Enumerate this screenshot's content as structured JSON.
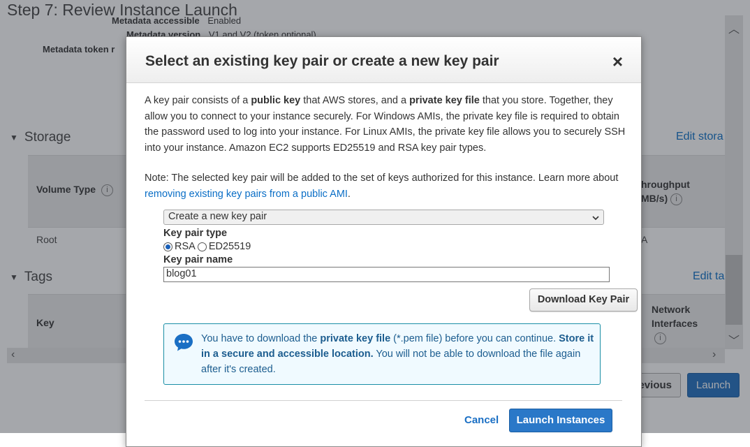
{
  "background": {
    "page_title": "Step 7: Review Instance Launch",
    "metadata_accessible_label": "Metadata accessible",
    "metadata_accessible_value": "Enabled",
    "metadata_version_label": "Metadata version",
    "metadata_version_value": "V1 and V2 (token optional)",
    "metadata_token_label": "Metadata token r",
    "storage_heading": "Storage",
    "storage_edit": "Edit stora",
    "volume_type_col": "Volume Type",
    "throughput_col_line1": "hroughput",
    "throughput_col_line2": "MB/s)",
    "root_cell": "Root",
    "na_cell": "A",
    "tags_heading": "Tags",
    "tags_edit": "Edit ta",
    "key_col": "Key",
    "network_col_line1": "Network",
    "network_col_line2": "Interfaces",
    "previous_button": "evious",
    "launch_button": "Launch",
    "info_glyph": "i"
  },
  "modal": {
    "title": "Select an existing key pair or create a new key pair",
    "close_glyph": "×",
    "intro": {
      "t1": "A key pair consists of a ",
      "b1": "public key",
      "t2": " that AWS stores, and a ",
      "b2": "private key file",
      "t3": " that you store. Together, they allow you to connect to your instance securely. For Windows AMIs, the private key file is required to obtain the password used to log into your instance. For Linux AMIs, the private key file allows you to securely SSH into your instance. Amazon EC2 supports ED25519 and RSA key pair types."
    },
    "note_text": "Note: The selected key pair will be added to the set of keys authorized for this instance. Learn more about ",
    "note_link": "removing existing key pairs from a public AMI",
    "note_end": ".",
    "keypair_select_value": "Create a new key pair",
    "key_pair_type_label": "Key pair type",
    "radio_rsa": "RSA",
    "radio_ed25519": "ED25519",
    "key_pair_name_label": "Key pair name",
    "key_pair_name_value": "blog01",
    "download_button": "Download Key Pair",
    "alert": {
      "t1": "You have to download the ",
      "b1": "private key file",
      "t2": " (*.pem file) before you can continue. ",
      "b2": "Store it in a secure and accessible location.",
      "t3": " You will not be able to download the file again after it's created."
    },
    "cancel_button": "Cancel",
    "launch_instances_button": "Launch Instances"
  },
  "colors": {
    "primary_blue": "#2a78c8",
    "link_blue": "#0a6ec6",
    "alert_border": "#1a8fa6",
    "alert_bg": "#f0faff"
  },
  "icons": [
    "close-icon",
    "chevron-down-icon",
    "chat-bubble-info-icon",
    "info-icon",
    "triangle-down-icon",
    "scroll-up-icon",
    "scroll-down-icon",
    "scroll-left-icon",
    "scroll-right-icon"
  ]
}
